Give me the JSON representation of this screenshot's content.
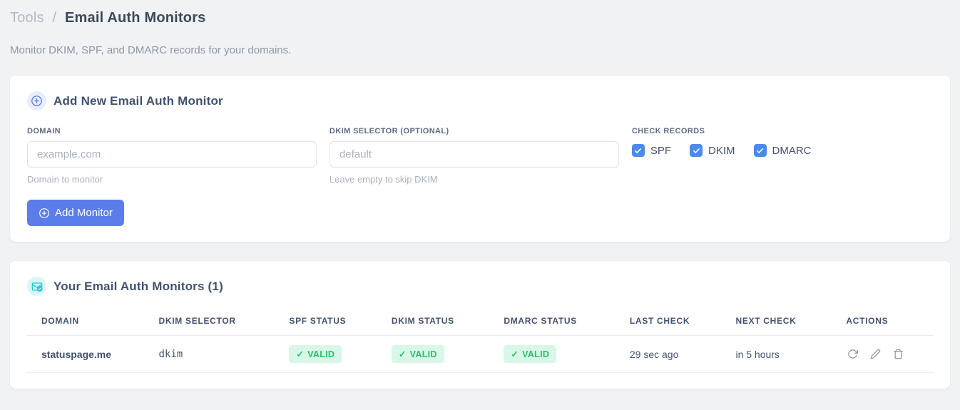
{
  "page": {
    "breadcrumb_section": "Tools",
    "breadcrumb_separator": "/",
    "title": "Email Auth Monitors",
    "subtitle": "Monitor DKIM, SPF, and DMARC records for your domains."
  },
  "add_monitor_card": {
    "title": "Add New Email Auth Monitor",
    "icon": "plus-circle-icon",
    "fields": {
      "domain": {
        "label": "DOMAIN",
        "placeholder": "example.com",
        "value": "",
        "helper": "Domain to monitor"
      },
      "dkim_selector": {
        "label": "DKIM SELECTOR (OPTIONAL)",
        "placeholder": "default",
        "value": "",
        "helper": "Leave empty to skip DKIM"
      }
    },
    "check_records": {
      "label": "CHECK RECORDS",
      "options": [
        {
          "label": "SPF",
          "checked": true
        },
        {
          "label": "DKIM",
          "checked": true
        },
        {
          "label": "DMARC",
          "checked": true
        }
      ]
    },
    "submit_label": "Add Monitor"
  },
  "monitors_card": {
    "title": "Your Email Auth Monitors (1)",
    "icon": "email-check-icon",
    "check_glyph": "✓",
    "table": {
      "headers": [
        "DOMAIN",
        "DKIM SELECTOR",
        "SPF STATUS",
        "DKIM STATUS",
        "DMARC STATUS",
        "LAST CHECK",
        "NEXT CHECK",
        "ACTIONS"
      ],
      "rows": [
        {
          "domain": "statuspage.me",
          "dkim_selector": "dkim",
          "spf_status": "VALID",
          "dkim_status": "VALID",
          "dmarc_status": "VALID",
          "last_check": "29 sec ago",
          "next_check": "in 5 hours",
          "actions": [
            "refresh",
            "edit",
            "delete"
          ]
        }
      ]
    }
  },
  "colors": {
    "accent_blue": "#5b7de9",
    "checkbox_blue": "#4b8bf0",
    "badge_green_bg": "#d9f7e6",
    "badge_green_text": "#27c16e",
    "selector_pink": "#ee4f9b",
    "header_icon_blue_bg": "#e7edfc",
    "header_icon_teal_bg": "#daf5f8",
    "header_icon_teal": "#29c8d9",
    "page_background": "#f1f2f4"
  }
}
